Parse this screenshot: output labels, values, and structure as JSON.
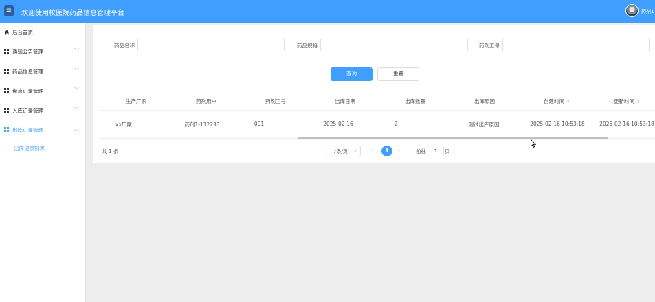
{
  "header": {
    "menu_icon": "menu-icon",
    "title": "欢迎使用校医院药品信息管理平台",
    "user_name": "药剂1",
    "avatar_icon": "avatar"
  },
  "sidebar": {
    "items": [
      {
        "label": "后台首页",
        "icon": "home-icon"
      },
      {
        "label": "通知公告管理",
        "icon": "grid-icon"
      },
      {
        "label": "药品信息管理",
        "icon": "grid-icon"
      },
      {
        "label": "盘点记录管理",
        "icon": "grid-icon"
      },
      {
        "label": "入库记录管理",
        "icon": "grid-icon"
      },
      {
        "label": "出库记录管理",
        "icon": "grid-icon",
        "active": true
      }
    ],
    "sub_item": "出库记录列表"
  },
  "search": {
    "fields": [
      {
        "label": "药品名称",
        "value": "",
        "placeholder": ""
      },
      {
        "label": "药品规格",
        "value": "",
        "placeholder": ""
      },
      {
        "label": "药剂工号",
        "value": "",
        "placeholder": ""
      }
    ],
    "query_label": "查询",
    "reset_label": "重置"
  },
  "table": {
    "columns": [
      "生产厂家",
      "药剂用户",
      "药剂工号",
      "出库日期",
      "出库数量",
      "出库原因",
      "创建时间",
      "更新时间"
    ],
    "rows": [
      [
        "xx厂家",
        "药剂1-112233",
        "001",
        "2025-02-16",
        "2",
        "测试出库原因",
        "2025-02-16 10:53:18",
        "2025-02-16 10:53:18"
      ]
    ]
  },
  "pagination": {
    "total_text": "共 1 条",
    "page_size": "7条/页",
    "current_page": "1",
    "goto_prefix": "前往",
    "goto_value": "1",
    "goto_suffix": "页"
  },
  "colors": {
    "primary": "#409eff",
    "header_bg": "#409eff",
    "page_bg": "#ededed"
  }
}
